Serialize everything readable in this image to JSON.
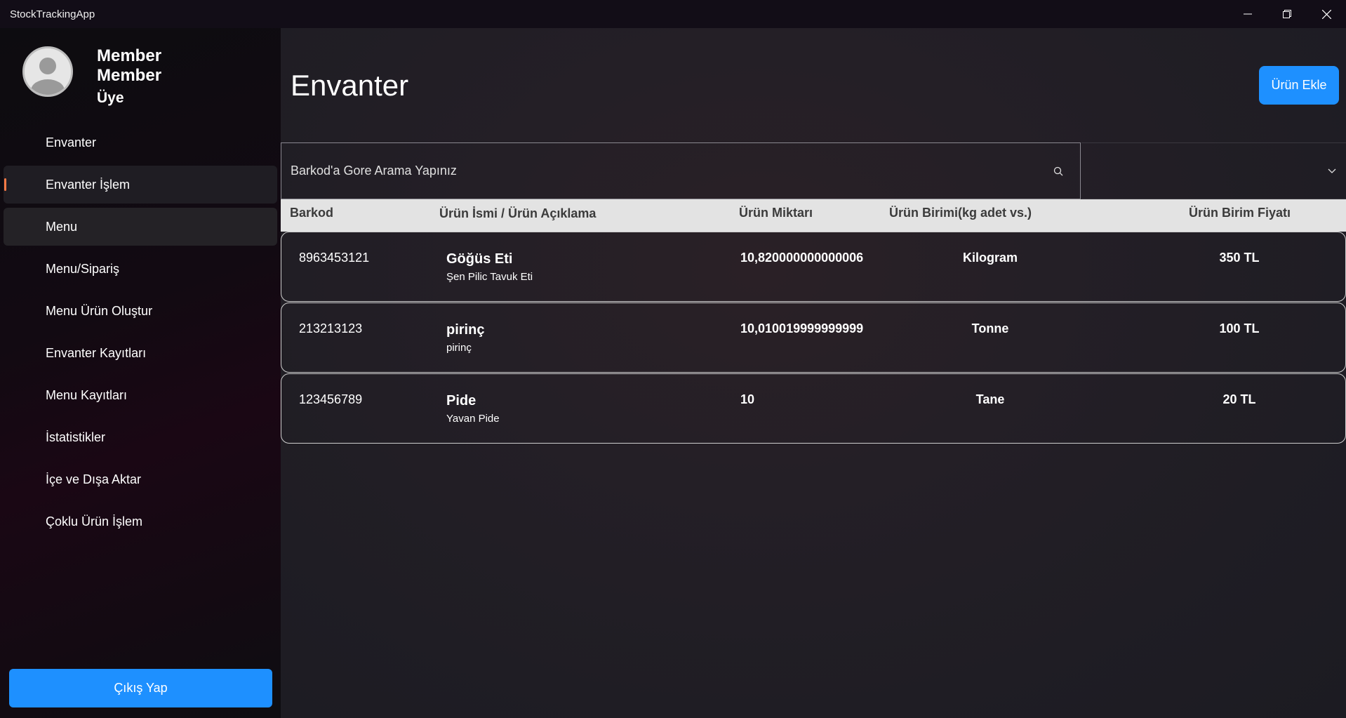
{
  "window": {
    "title": "StockTrackingApp"
  },
  "profile": {
    "name_line1": "Member",
    "name_line2": "Member",
    "role": "Üye"
  },
  "sidebar": {
    "items": [
      {
        "label": "Envanter"
      },
      {
        "label": "Envanter İşlem"
      },
      {
        "label": "Menu"
      },
      {
        "label": "Menu/Sipariş"
      },
      {
        "label": "Menu Ürün Oluştur"
      },
      {
        "label": "Envanter Kayıtları"
      },
      {
        "label": "Menu Kayıtları"
      },
      {
        "label": "İstatistikler"
      },
      {
        "label": "İçe ve Dışa Aktar"
      },
      {
        "label": "Çoklu Ürün İşlem"
      }
    ],
    "selected_index": 1,
    "logout_label": "Çıkış Yap"
  },
  "main": {
    "title": "Envanter",
    "add_button_label": "Ürün Ekle",
    "search_placeholder": "Barkod'a Gore Arama Yapınız",
    "dropdown_value": ""
  },
  "table": {
    "headers": {
      "barcode": "Barkod",
      "name": "Ürün İsmi / Ürün Açıklama",
      "quantity": "Ürün Miktarı",
      "unit": "Ürün Birimi(kg adet vs.)",
      "price": "Ürün Birim Fiyatı"
    },
    "rows": [
      {
        "barcode": "8963453121",
        "name": "Göğüs Eti",
        "description": "Şen Pilic Tavuk Eti",
        "quantity": "10,820000000000006",
        "unit": "Kilogram",
        "price": "350 TL"
      },
      {
        "barcode": "213213123",
        "name": "pirinç",
        "description": "pirinç",
        "quantity": "10,010019999999999",
        "unit": "Tonne",
        "price": "100 TL"
      },
      {
        "barcode": "123456789",
        "name": "Pide",
        "description": "Yavan Pide",
        "quantity": "10",
        "unit": "Tane",
        "price": "20 TL"
      }
    ]
  },
  "colors": {
    "accent_blue": "#1e90ff",
    "selection_indicator": "#ff7a45"
  },
  "icons": {
    "minimize": "minimize-icon",
    "restore": "restore-icon",
    "close": "close-icon",
    "search": "search-icon",
    "chevron": "chevron-down-icon",
    "avatar": "user-avatar-icon"
  }
}
